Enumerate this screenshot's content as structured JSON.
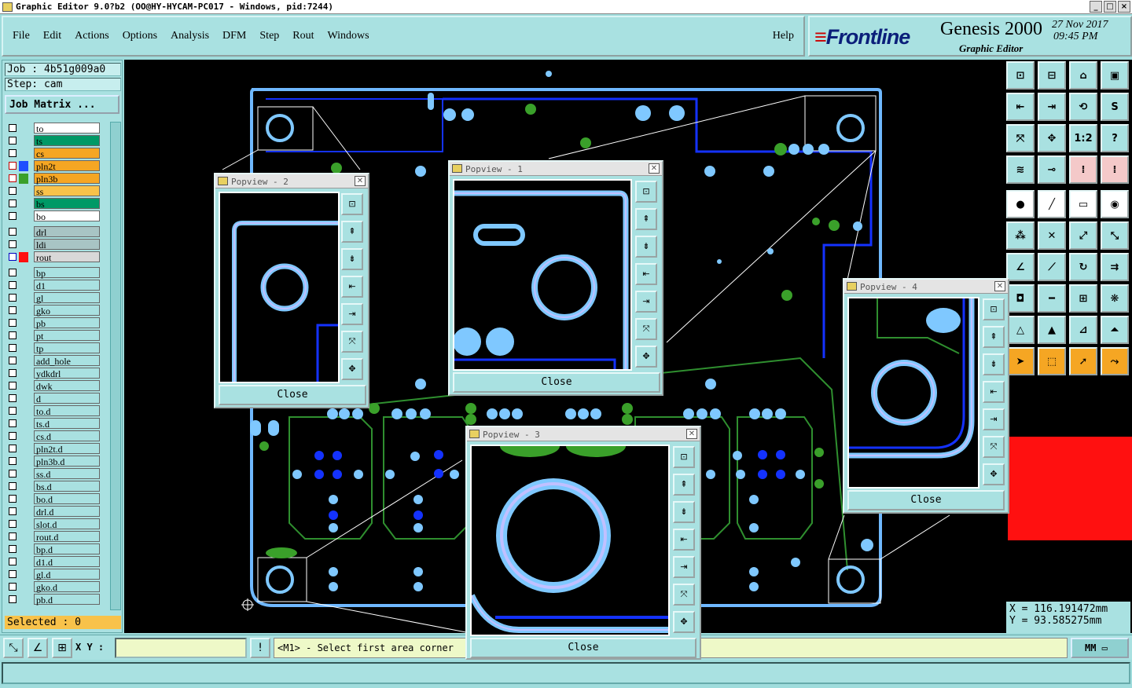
{
  "window": {
    "title": "Graphic Editor 9.0?b2 (OO@HY-HYCAM-PC017 - Windows, pid:7244)"
  },
  "menu": {
    "items": [
      "File",
      "Edit",
      "Actions",
      "Options",
      "Analysis",
      "DFM",
      "Step",
      "Rout",
      "Windows"
    ],
    "help": "Help"
  },
  "brand": {
    "logo": "Frontline",
    "product": "Genesis 2000",
    "subtitle": "Graphic Editor",
    "date": "27 Nov 2017",
    "time": "09:45 PM"
  },
  "job": {
    "job_label": "Job : 4b51g009a0",
    "step_label": "Step: cam",
    "matrix_button": "Job Matrix ..."
  },
  "layers": [
    {
      "name": "to",
      "color": "#ffffff",
      "check": "#000000"
    },
    {
      "name": "ts",
      "color": "#009966",
      "check": "#000000"
    },
    {
      "name": "cs",
      "color": "#f5a623",
      "check": "#000000"
    },
    {
      "name": "pln2t",
      "color": "#f5a623",
      "check": "#c00000",
      "swatch": "#1f4fff"
    },
    {
      "name": "pln3b",
      "color": "#f5a623",
      "check": "#c00000",
      "swatch": "#3aa02a"
    },
    {
      "name": "ss",
      "color": "#f8c24a",
      "check": "#000000"
    },
    {
      "name": "bs",
      "color": "#009966",
      "check": "#000000"
    },
    {
      "name": "bo",
      "color": "#ffffff",
      "check": "#000000"
    },
    {
      "name": "drl",
      "color": "#a8c4c4",
      "check": "#000000"
    },
    {
      "name": "ldi",
      "color": "#a8c4c4",
      "check": "#000000"
    },
    {
      "name": "rout",
      "color": "#d8d8d8",
      "check": "#0000c0",
      "swatch": "#ff1010"
    },
    {
      "name": "bp",
      "color": "#a9e1e1",
      "check": "#000000"
    },
    {
      "name": "d1",
      "color": "#a9e1e1",
      "check": "#000000"
    },
    {
      "name": "gl",
      "color": "#a9e1e1",
      "check": "#000000"
    },
    {
      "name": "gko",
      "color": "#a9e1e1",
      "check": "#000000"
    },
    {
      "name": "pb",
      "color": "#a9e1e1",
      "check": "#000000"
    },
    {
      "name": "pt",
      "color": "#a9e1e1",
      "check": "#000000"
    },
    {
      "name": "tp",
      "color": "#a9e1e1",
      "check": "#000000"
    },
    {
      "name": "add_hole",
      "color": "#a9e1e1",
      "check": "#000000"
    },
    {
      "name": "ydkdrl",
      "color": "#a9e1e1",
      "check": "#000000"
    },
    {
      "name": "dwk",
      "color": "#a9e1e1",
      "check": "#000000"
    },
    {
      "name": "d",
      "color": "#a9e1e1",
      "check": "#000000"
    },
    {
      "name": "to.d",
      "color": "#a9e1e1",
      "check": "#000000"
    },
    {
      "name": "ts.d",
      "color": "#a9e1e1",
      "check": "#000000"
    },
    {
      "name": "cs.d",
      "color": "#a9e1e1",
      "check": "#000000"
    },
    {
      "name": "pln2t.d",
      "color": "#a9e1e1",
      "check": "#000000"
    },
    {
      "name": "pln3b.d",
      "color": "#a9e1e1",
      "check": "#000000"
    },
    {
      "name": "ss.d",
      "color": "#a9e1e1",
      "check": "#000000"
    },
    {
      "name": "bs.d",
      "color": "#a9e1e1",
      "check": "#000000"
    },
    {
      "name": "bo.d",
      "color": "#a9e1e1",
      "check": "#000000"
    },
    {
      "name": "drl.d",
      "color": "#a9e1e1",
      "check": "#000000"
    },
    {
      "name": "slot.d",
      "color": "#a9e1e1",
      "check": "#000000"
    },
    {
      "name": "rout.d",
      "color": "#a9e1e1",
      "check": "#000000"
    },
    {
      "name": "bp.d",
      "color": "#a9e1e1",
      "check": "#000000"
    },
    {
      "name": "d1.d",
      "color": "#a9e1e1",
      "check": "#000000"
    },
    {
      "name": "gl.d",
      "color": "#a9e1e1",
      "check": "#000000"
    },
    {
      "name": "gko.d",
      "color": "#a9e1e1",
      "check": "#000000"
    },
    {
      "name": "pb.d",
      "color": "#a9e1e1",
      "check": "#000000"
    }
  ],
  "selected": "Selected : 0",
  "coords": {
    "x": "X  =  116.191472mm",
    "y": "Y  =  93.585275mm"
  },
  "bottom": {
    "xy_label": "X Y :",
    "xy_value": "",
    "status": "<M1> - Select first area corner",
    "units": "MM"
  },
  "popviews": {
    "p1": {
      "title": "Popview - 1",
      "close": "Close"
    },
    "p2": {
      "title": "Popview - 2",
      "close": "Close"
    },
    "p3": {
      "title": "Popview - 3",
      "close": "Close"
    },
    "p4": {
      "title": "Popview - 4",
      "close": "Close"
    }
  },
  "toolbar_labels": {
    "scale": "1:2",
    "help": "?"
  }
}
